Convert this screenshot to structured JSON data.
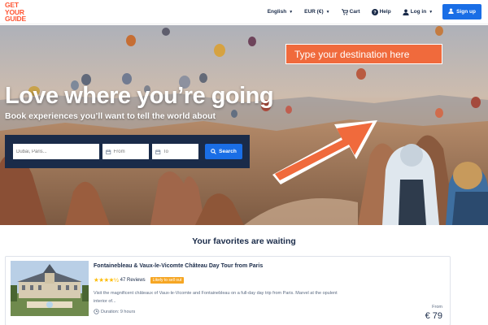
{
  "logo": {
    "line1": "GET",
    "line2": "YOUR",
    "line3": "GUIDE"
  },
  "nav": {
    "language": "English",
    "currency": "EUR (€)",
    "cart": "Cart",
    "help": "Help",
    "login": "Log in",
    "signup": "Sign up"
  },
  "hero": {
    "title": "Love where you’re going",
    "subtitle": "Book experiences you’ll want to tell the world about",
    "callout": "Type your destination here"
  },
  "search": {
    "destination_placeholder": "Dubai, Paris...",
    "from_placeholder": "From",
    "to_placeholder": "To",
    "button": "Search"
  },
  "favorites": {
    "heading": "Your favorites are waiting",
    "card": {
      "title": "Fontainebleau & Vaux-le-Vicomte Château Day Tour from Paris",
      "stars": "★★★★½",
      "reviews": "47 Reviews",
      "badge": "Likely to sell out",
      "description": "Visit the magnificent châteaux of Vaux-le-Vicomte and Fontainebleau on a full-day day trip from Paris. Marvel at the opulent interior of...",
      "duration": "Duration: 9 hours",
      "from_label": "From",
      "price": "€ 79"
    }
  },
  "colors": {
    "brand": "#ff5533",
    "primary": "#1a6ee6",
    "navy": "#1a2b49",
    "callout": "#f06a3c"
  }
}
